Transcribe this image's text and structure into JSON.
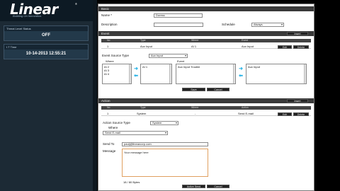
{
  "brand": {
    "logo": "Linear",
    "registered": "®",
    "tagline": "Building On Innovation."
  },
  "status": {
    "threat_label": "Threat Level Status",
    "threat_value": "OFF",
    "time_label": "I.T Time",
    "time_value": "10-14-2013 12:55:21"
  },
  "basic": {
    "section": "Basic",
    "name_label": "Name *",
    "name_value": "Duress",
    "description_label": "Description",
    "description_value": "",
    "schedule_label": "Schedule",
    "schedule_value": "Always"
  },
  "event": {
    "section": "Event",
    "insert": "Insert",
    "headers": [
      "No",
      "Type",
      "Where",
      "Event"
    ],
    "row": {
      "no": "1",
      "type": "Aux Input",
      "where": "AI 1",
      "event": "Aux Input",
      "edit": "Edit",
      "delete": "Delete"
    },
    "source_label": "Event Source Type",
    "source_value": "Aux Input",
    "where_title": "Where",
    "where_items": [
      "AI 2",
      "AI 3",
      "AI 4"
    ],
    "where_selected": [
      "AI 1"
    ],
    "event_title": "Event",
    "event_items": [
      "Aux Input Trouble"
    ],
    "event_selected": [
      "Aux Input"
    ],
    "save": "Save",
    "cancel": "Cancel"
  },
  "action": {
    "section": "Action",
    "insert": "Insert",
    "headers": [
      "No",
      "Type",
      "Where",
      "Action"
    ],
    "row": {
      "no": "1",
      "type": "System",
      "where": "-",
      "action": "Send E-mail",
      "edit": "Edit",
      "delete": "Delete"
    },
    "source_label": "Action Source Type",
    "source_value": "System",
    "where_title": "Where",
    "where_value": "Send E-mail",
    "send_to_label": "Send To",
    "send_to_value": "paulj@linearcorp.com",
    "message_label": "Message",
    "message_value": "Your message here",
    "bytes": "18 / 80 Bytes",
    "active_send": "Active Send",
    "cancel": "Cancel"
  },
  "colors": {
    "accent_arrow": "#2ab3e6",
    "section_bar": "#3a3a3a",
    "left_panel": "#1c2a35"
  }
}
